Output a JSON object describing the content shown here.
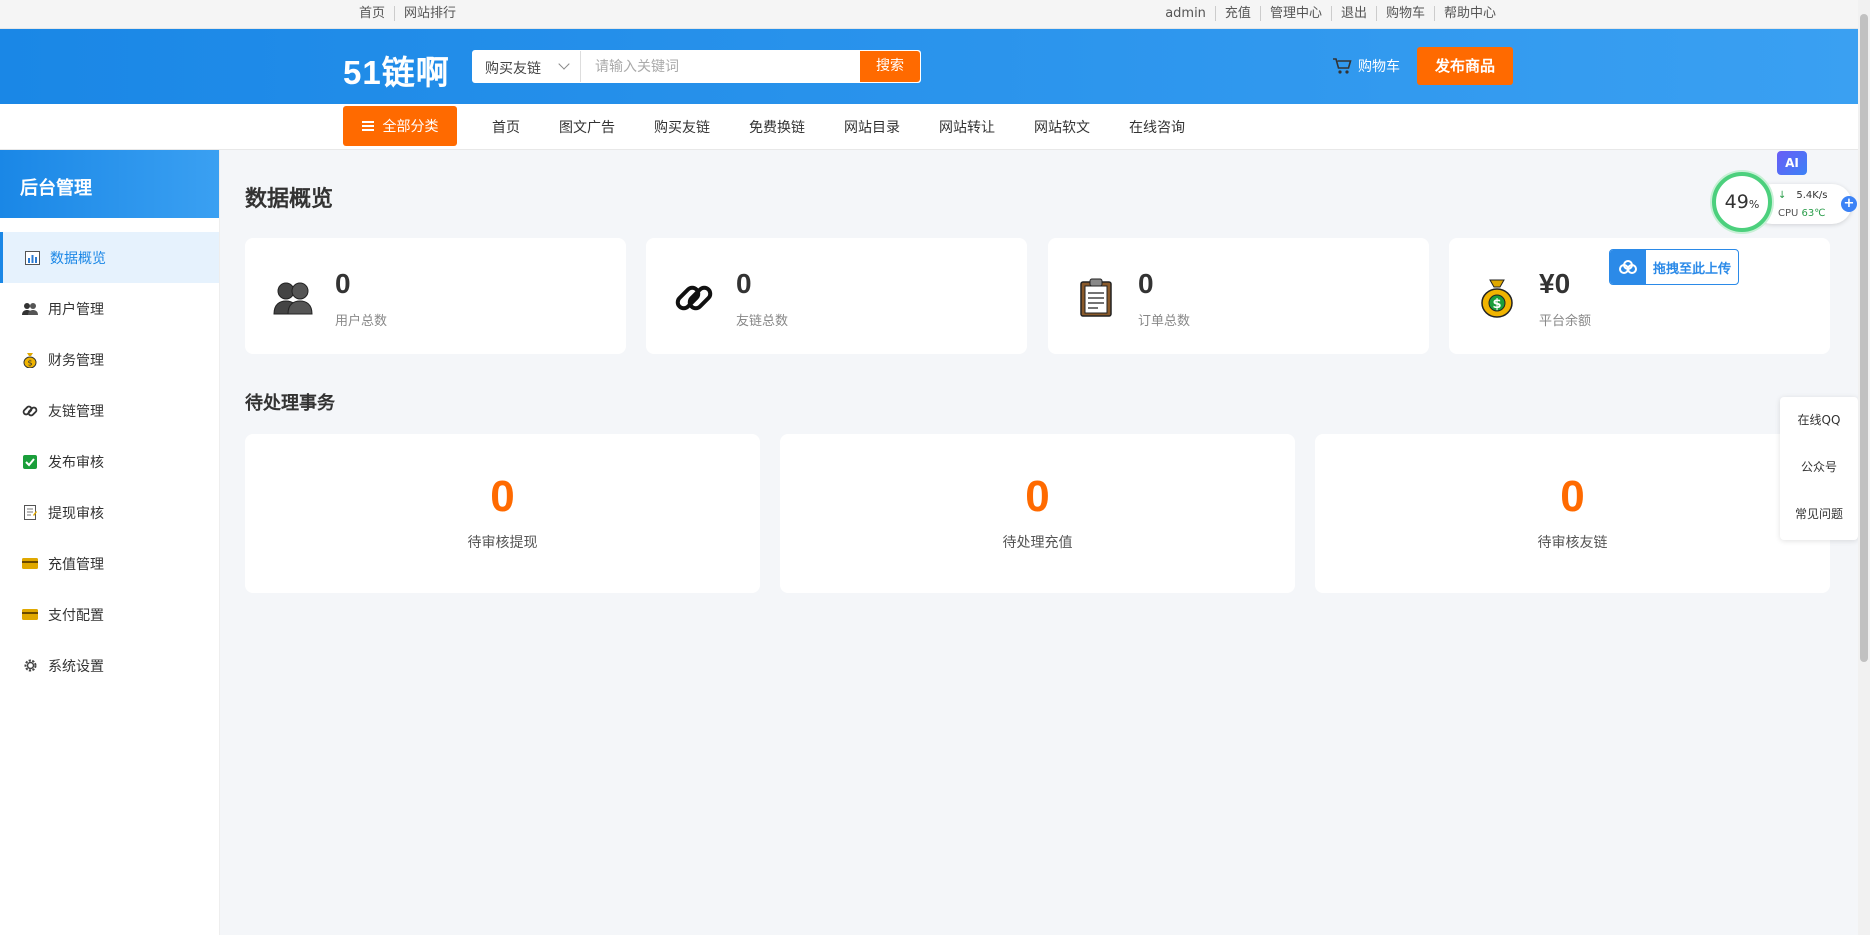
{
  "topbar": {
    "left_links": [
      "首页",
      "网站排行"
    ],
    "right_links": [
      "admin",
      "充值",
      "管理中心",
      "退出",
      "购物车",
      "帮助中心"
    ]
  },
  "header": {
    "logo": "51链啊",
    "search_category": "购买友链",
    "search_placeholder": "请输入关键词",
    "search_button": "搜索",
    "cart_label": "购物车",
    "publish_button": "发布商品"
  },
  "nav": {
    "all_categories": "全部分类",
    "links": [
      "首页",
      "图文广告",
      "购买友链",
      "免费换链",
      "网站目录",
      "网站转让",
      "网站软文",
      "在线咨询"
    ]
  },
  "sidebar": {
    "title": "后台管理",
    "items": [
      {
        "label": "数据概览",
        "icon": "bar-chart-icon"
      },
      {
        "label": "用户管理",
        "icon": "users-icon"
      },
      {
        "label": "财务管理",
        "icon": "money-bag-icon"
      },
      {
        "label": "友链管理",
        "icon": "link-icon"
      },
      {
        "label": "发布审核",
        "icon": "check-box-icon"
      },
      {
        "label": "提现审核",
        "icon": "memo-icon"
      },
      {
        "label": "充值管理",
        "icon": "credit-card-icon"
      },
      {
        "label": "支付配置",
        "icon": "credit-card-icon"
      },
      {
        "label": "系统设置",
        "icon": "gear-icon"
      }
    ]
  },
  "main": {
    "title": "数据概览",
    "stats": [
      {
        "value": "0",
        "label": "用户总数",
        "icon": "users-icon"
      },
      {
        "value": "0",
        "label": "友链总数",
        "icon": "link-icon"
      },
      {
        "value": "0",
        "label": "订单总数",
        "icon": "clipboard-icon"
      },
      {
        "value": "¥0",
        "label": "平台余额",
        "icon": "money-bag-icon"
      }
    ],
    "pending_title": "待处理事务",
    "pending": [
      {
        "value": "0",
        "label": "待审核提现"
      },
      {
        "value": "0",
        "label": "待处理充值"
      },
      {
        "value": "0",
        "label": "待审核友链"
      }
    ]
  },
  "side_float": [
    "在线QQ",
    "公众号",
    "常见问题"
  ],
  "overlay": {
    "ai_badge": "AI",
    "cpu_percent": "49",
    "cpu_percent_unit": "%",
    "net_speed": "5.4K/s",
    "cpu_label": "CPU",
    "cpu_temp": "63℃",
    "upload_label": "拖拽至此上传"
  },
  "colors": {
    "brand_blue": "#1a87e6",
    "accent_orange": "#ff6a00",
    "cpu_green": "#4cd07d"
  }
}
